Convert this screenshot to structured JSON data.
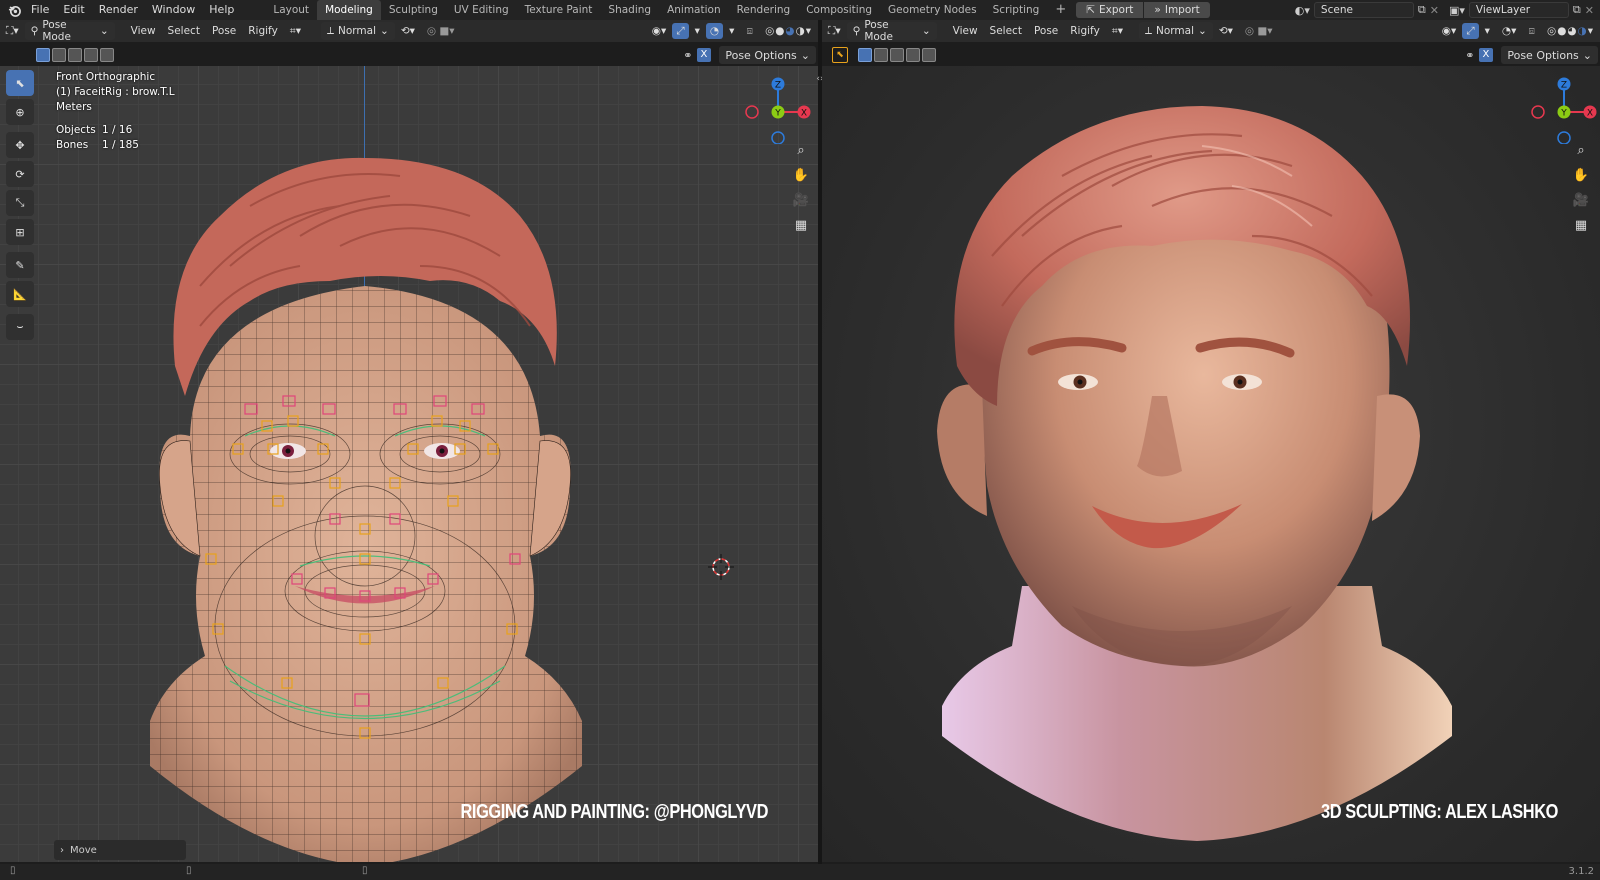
{
  "menu": {
    "items": [
      "File",
      "Edit",
      "Render",
      "Window",
      "Help"
    ]
  },
  "workspaces": {
    "tabs": [
      "Layout",
      "Modeling",
      "Sculpting",
      "UV Editing",
      "Texture Paint",
      "Shading",
      "Animation",
      "Rendering",
      "Compositing",
      "Geometry Nodes",
      "Scripting"
    ],
    "active": "Modeling",
    "add": "+"
  },
  "top": {
    "export_label": "Export",
    "import_label": "Import",
    "scene": "Scene",
    "view_layer": "ViewLayer"
  },
  "left_editor": {
    "mode": "Pose Mode",
    "menus": [
      "View",
      "Select",
      "Pose",
      "Rigify"
    ],
    "orientation": "Normal",
    "pose_options": "Pose Options",
    "x_label": "X",
    "overlay": {
      "view": "Front Orthographic",
      "active": "(1) FaceitRig : brow.T.L",
      "units": "Meters",
      "objects_label": "Objects",
      "objects_value": "1 / 16",
      "bones_label": "Bones",
      "bones_value": "1 / 185"
    },
    "credit": "RIGGING AND PAINTING: @PHONGLYVD",
    "last_op": "Move"
  },
  "right_editor": {
    "mode": "Pose Mode",
    "menus": [
      "View",
      "Select",
      "Pose",
      "Rigify"
    ],
    "orientation": "Normal",
    "pose_options": "Pose Options",
    "x_label": "X",
    "credit": "3D SCULPTING: ALEX LASHKO"
  },
  "gizmo": {
    "z": "Z",
    "y": "Y",
    "x": "X"
  },
  "status": {
    "version": "3.1.2"
  },
  "colors": {
    "accent": "#4772b3",
    "gizmo_x": "#e6384f",
    "gizmo_y": "#8ccc14",
    "gizmo_z": "#2d7bdb",
    "skin": "#d9a98a",
    "hair": "#c4685a"
  }
}
